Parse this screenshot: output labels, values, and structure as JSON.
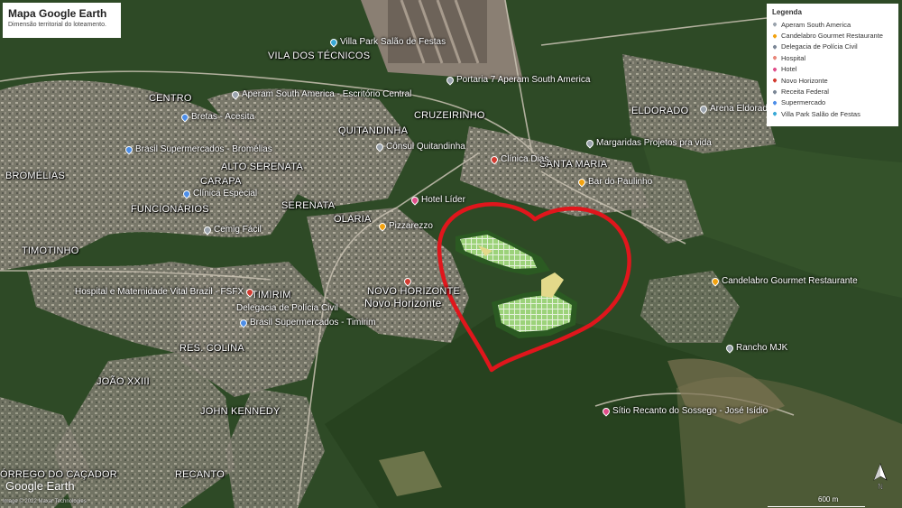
{
  "title_box": {
    "title": "Mapa Google Earth",
    "subtitle": "Dimensão territorial do loteamento."
  },
  "legend": {
    "title": "Legenda",
    "items": [
      {
        "label": "Aperam South America",
        "color": "#9aa3ad"
      },
      {
        "label": "Candelabro Gourmet Restaurante",
        "color": "#f2a20f"
      },
      {
        "label": "Delegacia de Polícia Civil",
        "color": "#7b8796"
      },
      {
        "label": "Hospital",
        "color": "#e8877a"
      },
      {
        "label": "Hotel",
        "color": "#e04e8a"
      },
      {
        "label": "Novo Horizonte",
        "color": "#d23b30"
      },
      {
        "label": "Receita Federal",
        "color": "#7b8796"
      },
      {
        "label": "Supermercado",
        "color": "#4d8ee8"
      },
      {
        "label": "Villa Park Salão de Festas",
        "color": "#39a9d6"
      }
    ]
  },
  "neighborhoods": {
    "vila_dos_tecnicos": "VILA DOS TÉCNICOS",
    "centro": "CENTRO",
    "cruzeirinho": "CRUZEIRINHO",
    "quitandinha": "QUITANDINHA",
    "eldorado": "ELDORADO",
    "bromelias": "BROMÉLIAS",
    "alto_serenata": "ALTO SERENATA",
    "santa_maria": "SANTA MARIA",
    "garapa": "CARAPA",
    "funcionarios": "FUNCIONÁRIOS",
    "serenata": "SERENATA",
    "olaria": "OLARIA",
    "timotinho": "TIMOTINHO",
    "timirim": "TIMIRIM",
    "novo_horizonte_upper": "NOVO HORIZONTE",
    "novo_horizonte": "Novo Horizonte",
    "res_colina": "RES. COLINA",
    "joao_xxiii": "JOÃO XXIII",
    "john_kennedy": "JOHN KENNEDY",
    "corrego": "ÓRREGO DO CAÇADOR",
    "recanto": "RECANTO"
  },
  "pois": {
    "villa_park": "Villa Park Salão de Festas",
    "portaria": "Portaria 7 Aperam South America",
    "aperam_escritorio": "Aperam South America - Escritório Central",
    "arena_eldorado": "Arena Eldorado",
    "bretas": "Bretas - Acesita",
    "brasil_bromelias": "Brasil Supermercados - Bromélias",
    "consul": "Cônsul Quitandinha",
    "margaridas": "Margaridas Projetos pra vida",
    "clinica_dias": "Clínica Dias",
    "bar_paulinho": "Bar do Paulinho",
    "clinica_especial": "Clínica Especial",
    "hotel_lider": "Hotel Líder",
    "cemig": "Cemig Fácil",
    "pizzarezzo": "Pizzarezzo",
    "candelabro": "Candelabro Gourmet Restaurante",
    "hospital": "Hospital e Maternidade Vital Brazil - FSFX",
    "delegacia": "Delegacia de Polícia Civil",
    "brasil_timirim": "Brasil Supermercados - Timirim",
    "rancho": "Rancho MJK",
    "sitio": "Sítio Recanto do Sossego - José Isídio"
  },
  "footer": {
    "logo": "Google Earth",
    "credit": "Image © 2022 Maxar Technologies",
    "scale": "600 m",
    "compass": "N"
  },
  "colors": {
    "highlight": "#e0161c",
    "development": "#7fbf5a"
  }
}
